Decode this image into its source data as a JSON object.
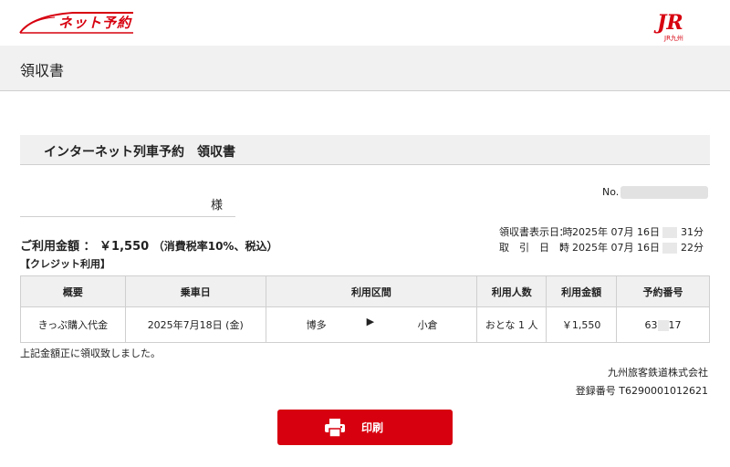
{
  "header": {
    "logo_text": "ネット予約",
    "jr_mark": "JR",
    "jr_sub": "JR九州"
  },
  "page": {
    "title": "領収書"
  },
  "receipt": {
    "heading": "インターネット列車予約　領収書",
    "customer_suffix": "様",
    "number_label": "No.",
    "issue_date_label": "領収書表示日 時",
    "issue_date_value_a": "：  2025年 07月 16日",
    "issue_date_value_b": "31分",
    "transaction_date_label": "取　引　日　時",
    "transaction_date_value_a": "：  2025年 07月 16日",
    "transaction_date_value_b": "22分",
    "amount_label": "ご利用金額 ： ￥1,550",
    "amount_tax": "（消費税率10%、税込）",
    "payment_method": "【クレジット利用】"
  },
  "table": {
    "headers": [
      "概要",
      "乗車日",
      "利用区間",
      "利用人数",
      "利用金額",
      "予約番号"
    ],
    "row": {
      "summary": "きっぷ購入代金",
      "date": "2025年7月18日 (金)",
      "from": "博多",
      "arrow": "▶",
      "to": "小倉",
      "people": "おとな  1 人",
      "amount": "￥1,550",
      "reservation_a": "63",
      "reservation_b": "17"
    }
  },
  "footer": {
    "note": "上記金額正に領収致しました。",
    "company": "九州旅客鉄道株式会社",
    "registration": "登録番号 T6290001012621"
  },
  "actions": {
    "print_label": "印刷"
  },
  "colors": {
    "brand_red": "#d7000f",
    "band_gray": "#f0f0f0",
    "border_gray": "#cfcfcf"
  }
}
